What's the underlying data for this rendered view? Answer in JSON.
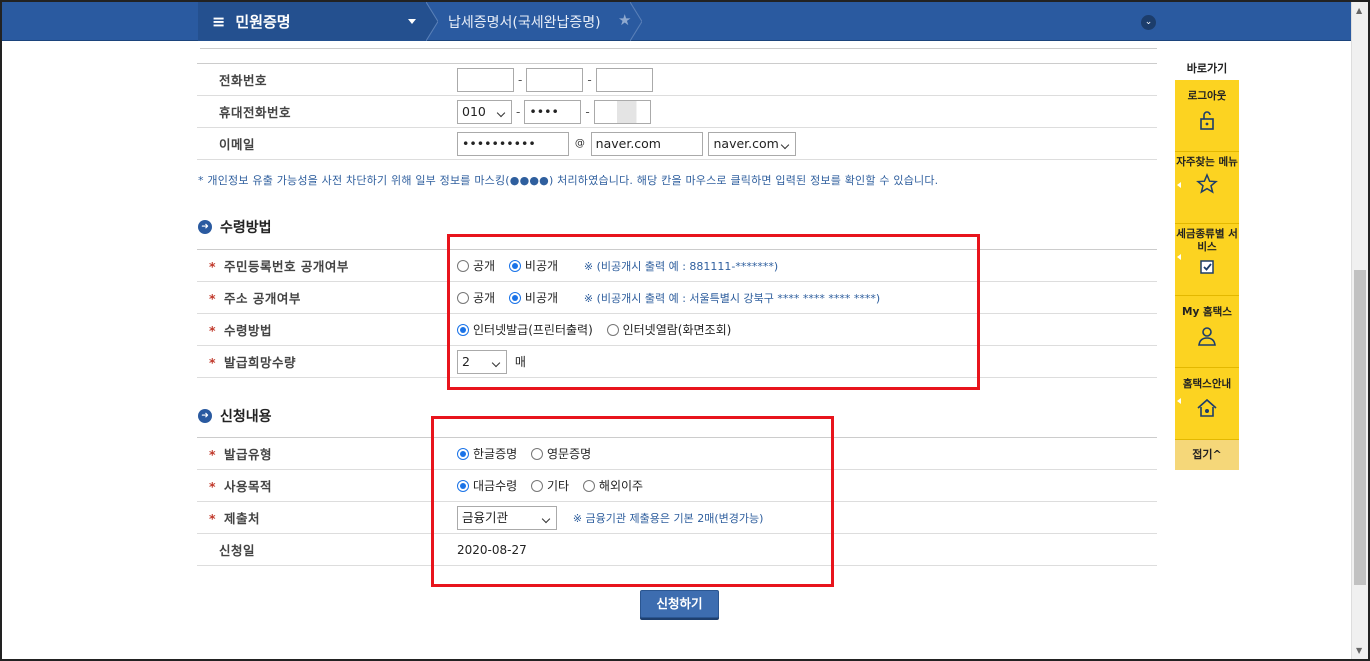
{
  "topbar": {
    "menu_title": "민원증명",
    "breadcrumb": "납세증명서(국세완납증명)"
  },
  "contact": {
    "phone_label": "전화번호",
    "mobile_label": "휴대전화번호",
    "mobile_prefix": "010",
    "mobile_middle": "••••",
    "email_label": "이메일",
    "email_id": "••••••••••",
    "email_at": "@",
    "email_domain": "naver.com",
    "email_domain_select": "naver.com"
  },
  "note": "* 개인정보 유출 가능성을 사전 차단하기 위해 일부 정보를 마스킹(●●●●) 처리하였습니다. 해당 칸을 마우스로 클릭하면 입력된 정보를 확인할 수 있습니다.",
  "receive": {
    "section_title": "수령방법",
    "rrn_label": "주민등록번호 공개여부",
    "public": "공개",
    "private": "비공개",
    "rrn_hint": "※ (비공개시 출력 예 : 881111-*******)",
    "addr_label": "주소 공개여부",
    "addr_hint": "※ (비공개시 출력 예 : 서울특별시 강북구 **** **** **** ****)",
    "method_label": "수령방법",
    "method_internet_issue": "인터넷발급(프린터출력)",
    "method_internet_view": "인터넷열람(화면조회)",
    "qty_label": "발급희망수량",
    "qty_value": "2",
    "qty_unit": "매"
  },
  "apply": {
    "section_title": "신청내용",
    "type_label": "발급유형",
    "type_korean": "한글증명",
    "type_english": "영문증명",
    "purpose_label": "사용목적",
    "purpose_loan": "대금수령",
    "purpose_other": "기타",
    "purpose_emigration": "해외이주",
    "submit_to_label": "제출처",
    "submit_to_value": "금융기관",
    "submit_hint": "※ 금융기관 제출용은 기본 2매(변경가능)",
    "date_label": "신청일",
    "date_value": "2020-08-27",
    "button": "신청하기"
  },
  "quickmenu": {
    "title": "바로가기",
    "items": [
      "로그아웃",
      "자주찾는 메뉴",
      "세금종류별 서비스",
      "My 홈택스",
      "홈택스안내"
    ],
    "fold": "접기^"
  },
  "colors": {
    "topbar": "#2a5aa0",
    "accent_red": "#e8141c",
    "quick_yellow": "#fcd321"
  }
}
